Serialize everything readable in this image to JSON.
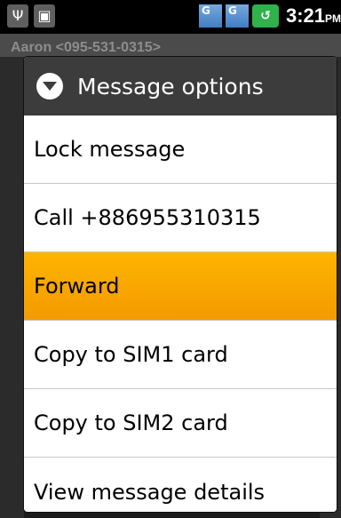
{
  "status_bar": {
    "time": "3:21",
    "ampm": "PM",
    "usb_glyph": "Ψ",
    "android_glyph": "▣",
    "net1": "G",
    "net2": "G",
    "battery_glyph": "↺",
    "icons": [
      "usb-icon",
      "android-debug-icon",
      "signal-g-icon",
      "signal-g-icon",
      "battery-icon"
    ]
  },
  "background": {
    "contact": "Aaron <095-531-0315>"
  },
  "dialog": {
    "title": "Message options",
    "items": [
      {
        "label": "Lock message",
        "selected": false
      },
      {
        "label": "Call +886955310315",
        "selected": false
      },
      {
        "label": "Forward",
        "selected": true
      },
      {
        "label": "Copy to SIM1 card",
        "selected": false
      },
      {
        "label": "Copy to SIM2 card",
        "selected": false
      },
      {
        "label": "View message details",
        "selected": false
      }
    ]
  },
  "colors": {
    "highlight": "#f6a400",
    "header_bg": "#3c3c3c"
  }
}
